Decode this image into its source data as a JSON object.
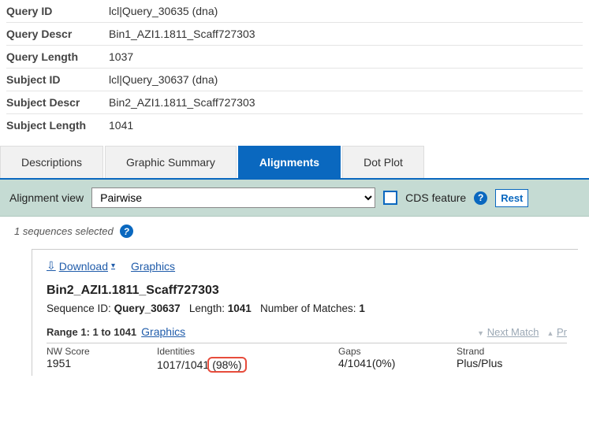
{
  "meta": {
    "query_id_label": "Query ID",
    "query_id_value": "lcl|Query_30635 (dna)",
    "query_descr_label": "Query Descr",
    "query_descr_value": "Bin1_AZI1.1811_Scaff727303",
    "query_length_label": "Query Length",
    "query_length_value": "1037",
    "subject_id_label": "Subject ID",
    "subject_id_value": "lcl|Query_30637 (dna)",
    "subject_descr_label": "Subject Descr",
    "subject_descr_value": "Bin2_AZI1.1811_Scaff727303",
    "subject_length_label": "Subject Length",
    "subject_length_value": "1041"
  },
  "tabs": {
    "descriptions": "Descriptions",
    "graphic_summary": "Graphic Summary",
    "alignments": "Alignments",
    "dot_plot": "Dot Plot"
  },
  "alignbar": {
    "label": "Alignment view",
    "selected": "Pairwise",
    "cds_label": "CDS feature",
    "reset": "Rest"
  },
  "selbar": {
    "text": "1 sequences selected"
  },
  "links": {
    "download": "Download",
    "graphics": "Graphics"
  },
  "sequence": {
    "title": "Bin2_AZI1.1811_Scaff727303",
    "seqid_label": "Sequence ID: ",
    "seqid_value": "Query_30637",
    "length_label": "Length: ",
    "length_value": "1041",
    "matches_label": "Number of Matches: ",
    "matches_value": "1"
  },
  "range": {
    "label": "Range 1: 1 to 1041",
    "graphics": "Graphics",
    "next": "Next Match",
    "prev": "Pr"
  },
  "stats": {
    "nw_label": "NW Score",
    "nw_value": "1951",
    "ident_label": "Identities",
    "ident_value_pre": "1017/1041",
    "ident_value_hl": "(98%)",
    "gaps_label": "Gaps",
    "gaps_value": "4/1041(0%)",
    "strand_label": "Strand",
    "strand_value": "Plus/Plus"
  }
}
